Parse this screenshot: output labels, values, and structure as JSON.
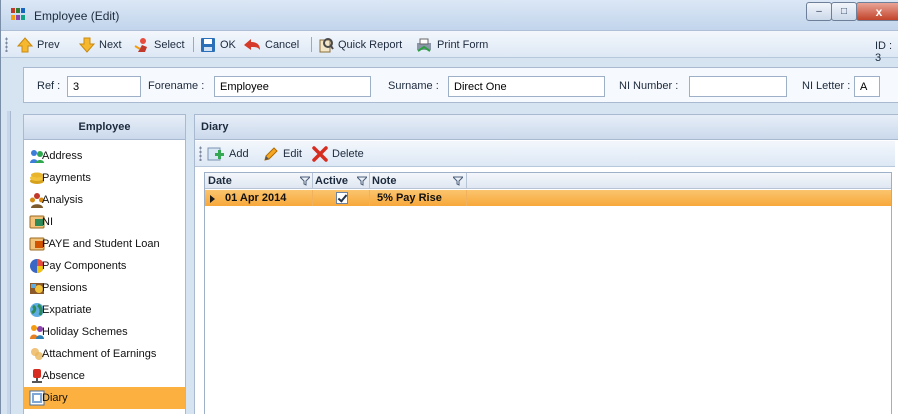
{
  "window": {
    "title": "Employee (Edit)",
    "controls": {
      "minimize": "–",
      "maximize": "□",
      "close": "x"
    }
  },
  "toolbar": {
    "prev": "Prev",
    "next": "Next",
    "select": "Select",
    "ok": "OK",
    "cancel": "Cancel",
    "quick_report": "Quick Report",
    "print_form": "Print Form",
    "id_label": "ID : 3"
  },
  "header_fields": {
    "ref_label": "Ref :",
    "ref_value": "3",
    "forename_label": "Forename :",
    "forename_value": "Employee",
    "surname_label": "Surname :",
    "surname_value": "Direct One",
    "ni_number_label": "NI Number :",
    "ni_number_value": "",
    "ni_letter_label": "NI Letter :",
    "ni_letter_value": "A"
  },
  "sidebar": {
    "title": "Employee",
    "items": [
      {
        "label": "Address",
        "icon": "people-icon"
      },
      {
        "label": "Payments",
        "icon": "coins-icon"
      },
      {
        "label": "Analysis",
        "icon": "group-icon"
      },
      {
        "label": "NI",
        "icon": "ni-card-icon"
      },
      {
        "label": "PAYE and Student Loan",
        "icon": "paye-icon"
      },
      {
        "label": "Pay Components",
        "icon": "pie-chart-icon"
      },
      {
        "label": "Pensions",
        "icon": "pension-icon"
      },
      {
        "label": "Expatriate",
        "icon": "globe-icon"
      },
      {
        "label": "Holiday Schemes",
        "icon": "holiday-icon"
      },
      {
        "label": "Attachment of Earnings",
        "icon": "attachment-icon"
      },
      {
        "label": "Absence",
        "icon": "absence-icon"
      },
      {
        "label": "Diary",
        "icon": "diary-icon",
        "active": true
      }
    ]
  },
  "main": {
    "title": "Diary",
    "actions": {
      "add": "Add",
      "edit": "Edit",
      "delete": "Delete"
    },
    "grid": {
      "columns": [
        "Date",
        "Active",
        "Note"
      ],
      "rows": [
        {
          "date": "01 Apr 2014",
          "active": true,
          "note": "5% Pay Rise"
        }
      ]
    }
  },
  "colors": {
    "selection": "#f7a83a",
    "active_sidebar": "#fbb040",
    "chrome": "#d6e4f2"
  }
}
